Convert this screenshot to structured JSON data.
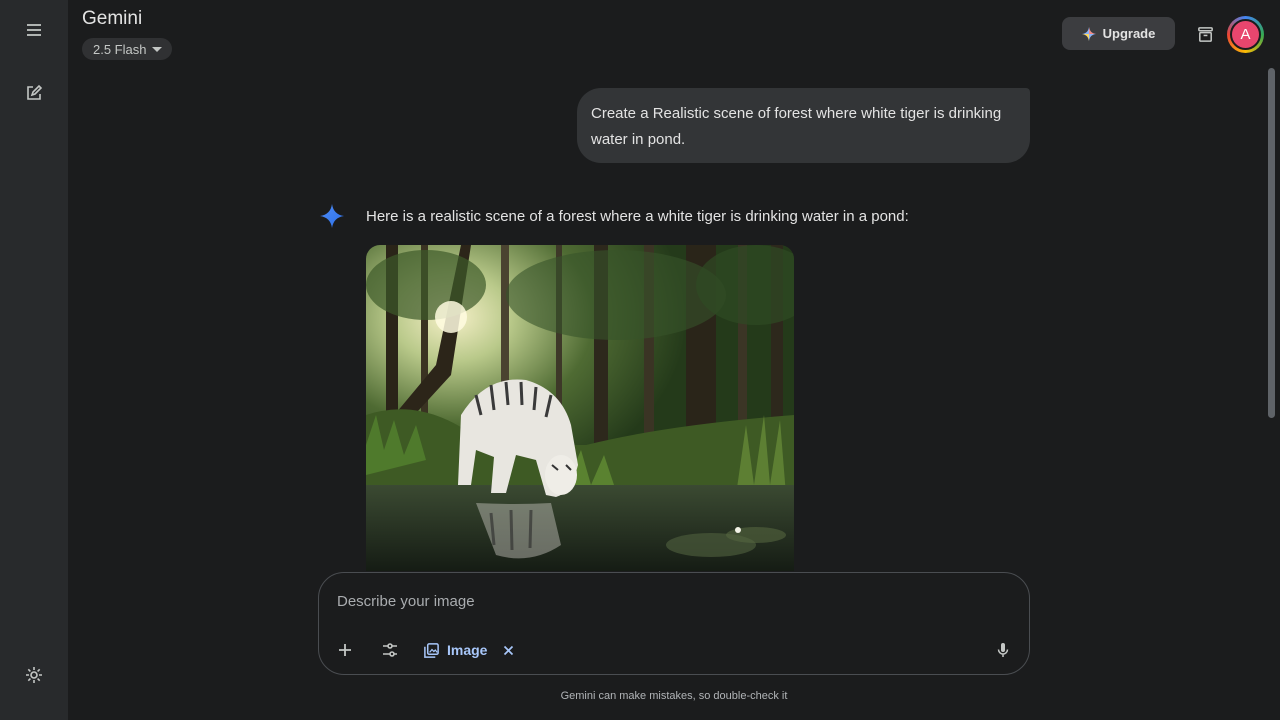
{
  "app": {
    "title": "Gemini"
  },
  "model_picker": {
    "label": "2.5 Flash"
  },
  "header": {
    "upgrade_label": "Upgrade",
    "avatar_initial": "A"
  },
  "sidebar": {
    "icons": [
      "menu-icon",
      "new-chat-icon",
      "settings-icon"
    ]
  },
  "conversation": {
    "user_message": "Create a Realistic scene of forest where white tiger is drinking water in pond.",
    "assistant_message": "Here is a realistic scene of a forest where a white tiger is drinking water in a pond:"
  },
  "composer": {
    "placeholder": "Describe your image",
    "value": "",
    "chip_label": "Image"
  },
  "footer": {
    "disclaimer": "Gemini can make mistakes, so double-check it"
  },
  "colors": {
    "background": "#1b1c1d",
    "sidebar": "#282a2c",
    "user_bubble": "#333537",
    "accent": "#a8c7fa",
    "sparkle": "#4285f4",
    "avatar": "#e8466e"
  }
}
